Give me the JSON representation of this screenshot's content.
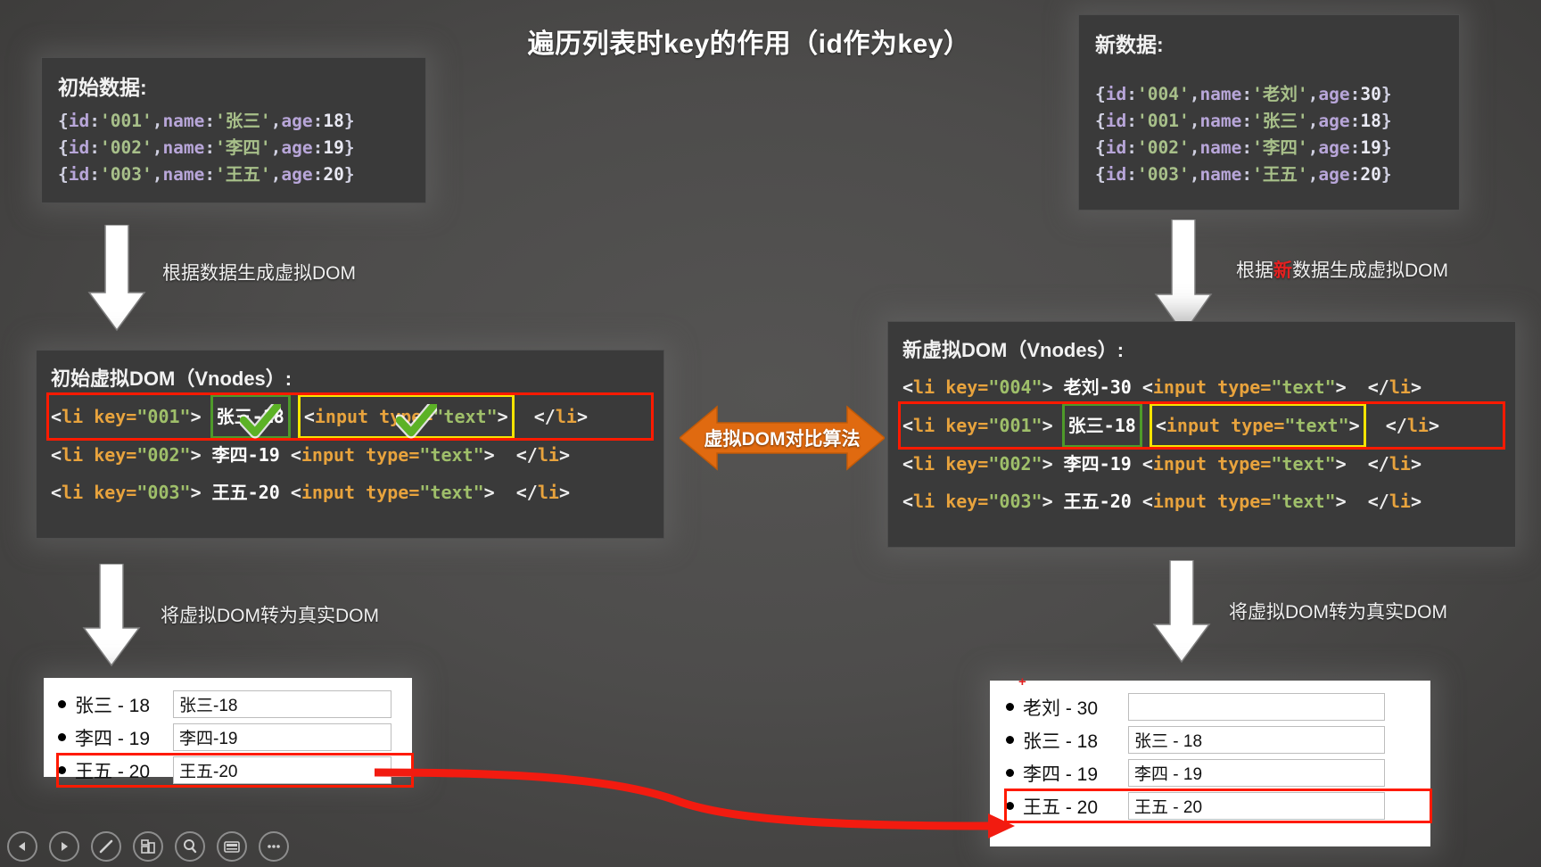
{
  "title": "遍历列表时key的作用（id作为key）",
  "initial_data": {
    "heading": "初始数据:",
    "rows": [
      {
        "id": "001",
        "name": "张三",
        "age": "18"
      },
      {
        "id": "002",
        "name": "李四",
        "age": "19"
      },
      {
        "id": "003",
        "name": "王五",
        "age": "20"
      }
    ]
  },
  "new_data": {
    "heading": "新数据:",
    "rows": [
      {
        "id": "004",
        "name": "老刘",
        "age": "30"
      },
      {
        "id": "001",
        "name": "张三",
        "age": "18"
      },
      {
        "id": "002",
        "name": "李四",
        "age": "19"
      },
      {
        "id": "003",
        "name": "王五",
        "age": "20"
      }
    ]
  },
  "initial_vdom": {
    "heading": "初始虚拟DOM（Vnodes）:",
    "lines": [
      {
        "key": "001",
        "text": "张三-18",
        "highlight": true
      },
      {
        "key": "002",
        "text": "李四-19",
        "highlight": false
      },
      {
        "key": "003",
        "text": "王五-20",
        "highlight": false
      }
    ],
    "tag_open": "<li",
    "attr": "key=",
    "gt": ">",
    "input": "<input type=\"text\">",
    "tag_close": "</li>"
  },
  "new_vdom": {
    "heading": "新虚拟DOM（Vnodes）:",
    "lines": [
      {
        "key": "004",
        "text": "老刘-30",
        "highlight": false
      },
      {
        "key": "001",
        "text": "张三-18",
        "highlight": true
      },
      {
        "key": "002",
        "text": "李四-19",
        "highlight": false
      },
      {
        "key": "003",
        "text": "王五-20",
        "highlight": false
      }
    ],
    "tag_open": "<li",
    "attr": "key=",
    "gt": ">",
    "input": "<input type=\"text\">",
    "tag_close": "</li>"
  },
  "initial_real_dom": {
    "rows": [
      {
        "label": "张三 - 18",
        "value": "张三-18",
        "highlight": false
      },
      {
        "label": "李四 - 19",
        "value": "李四-19",
        "highlight": false
      },
      {
        "label": "王五 - 20",
        "value": "王五-20",
        "highlight": true
      }
    ]
  },
  "new_real_dom": {
    "rows": [
      {
        "label": "老刘 - 30",
        "value": "",
        "highlight": false
      },
      {
        "label": "张三 - 18",
        "value": "张三 - 18",
        "highlight": false
      },
      {
        "label": "李四 - 19",
        "value": "李四 - 19",
        "highlight": false
      },
      {
        "label": "王五 - 20",
        "value": "王五 - 20",
        "highlight": true
      }
    ]
  },
  "annotations": {
    "left_gen": "根据数据生成虚拟DOM",
    "right_gen_prefix": "根据",
    "right_gen_hot": "新",
    "right_gen_suffix": "数据生成虚拟DOM",
    "left_render": "将虚拟DOM转为真实DOM",
    "right_render": "将虚拟DOM转为真实DOM",
    "diff_label": "虚拟DOM对比算法"
  },
  "colors": {
    "background": "#4a4a4a",
    "panel": "#3a3a3a",
    "accent_orange": "#e06a10",
    "highlight_red": "#ff1a00",
    "highlight_yellow": "#f5e400",
    "highlight_green": "#4e9a2a",
    "tag": "#e8a33d",
    "string": "#9fbf6a"
  },
  "toolbar": {
    "items": [
      {
        "name": "previous-slide-icon",
        "glyph": "◀"
      },
      {
        "name": "next-slide-icon",
        "glyph": "▶"
      },
      {
        "name": "pen-icon",
        "glyph": "/"
      },
      {
        "name": "layout-icon",
        "glyph": "▤"
      },
      {
        "name": "search-icon",
        "glyph": "⌕"
      },
      {
        "name": "keyboard-icon",
        "glyph": "▬"
      },
      {
        "name": "more-options-icon",
        "glyph": "•••"
      }
    ]
  }
}
